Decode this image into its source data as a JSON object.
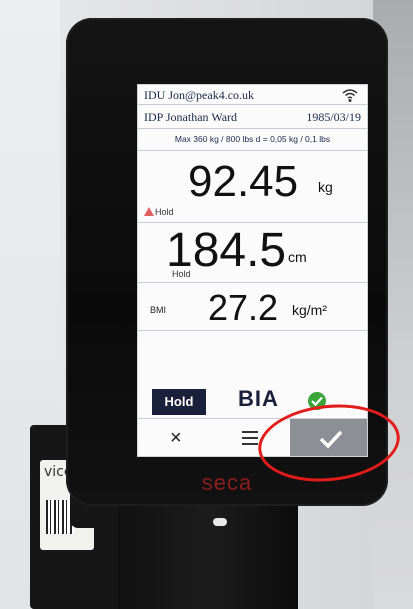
{
  "screen": {
    "idu_line": "IDU Jon@peak4.co.uk",
    "idp_line": "IDP Jonathan Ward",
    "idp_date": "1985/03/19",
    "limits": "Max 360 kg / 800 lbs  d = 0,05 kg / 0,1 lbs",
    "weight": {
      "value": "92.45",
      "unit": "kg",
      "status": "Hold"
    },
    "height": {
      "value": "184.5",
      "unit": "cm",
      "status": "Hold"
    },
    "bmi": {
      "label": "BMI",
      "value": "27.2",
      "unit": "kg/m²"
    },
    "hold_button": "Hold",
    "bia_label": "BIA",
    "cancel_glyph": "×",
    "confirm_glyph": "✓"
  },
  "device": {
    "brand": "seca"
  },
  "label_sticker": "vice",
  "colors": {
    "annotation": "#e21b1b",
    "check_badge": "#3aa63a",
    "hold_button_bg": "#1a1f3a",
    "brand": "#8b1d1d"
  },
  "icons": [
    "wifi-icon",
    "warning-icon",
    "check-badge-icon",
    "close-icon",
    "menu-icon",
    "check-icon"
  ]
}
